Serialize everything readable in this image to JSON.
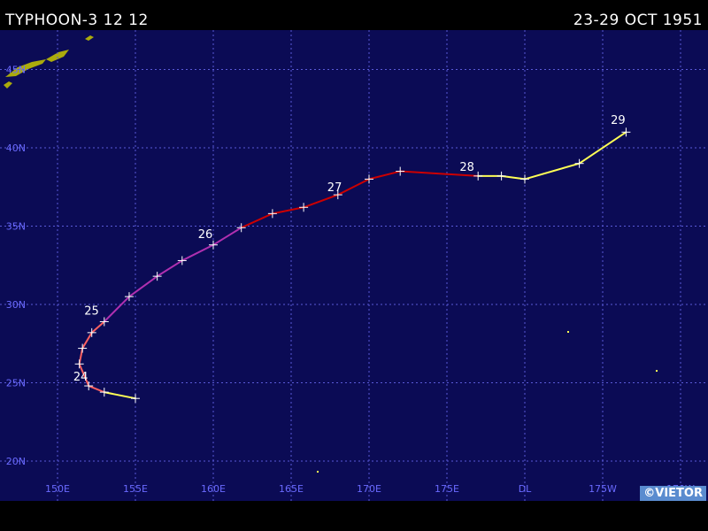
{
  "header": {
    "title": "TYPHOON-3 12 12",
    "dates": "23-29 OCT 1951"
  },
  "copyright": "©VIETOR",
  "colors": {
    "ocean": "#0b0b55",
    "grid": "#5a5ad8",
    "grid_label": "#6a6aff",
    "land": "#c8c800",
    "track_extratropical": "#ffff55",
    "track_tropical_storm": "#ff6060",
    "track_typhoon_cat1": "#cc0000",
    "track_typhoon_cat2": "#b030b0"
  },
  "axes": {
    "longitude_labels": [
      "150E",
      "155E",
      "160E",
      "165E",
      "170E",
      "175E",
      "DL",
      "175W",
      "170W"
    ],
    "latitude_labels": [
      "45N",
      "40N",
      "35N",
      "30N",
      "25N",
      "20N"
    ]
  },
  "chart_data": {
    "type": "scatter",
    "x_range_lon": [
      148,
      193
    ],
    "y_range_lat": [
      18.5,
      44.5
    ],
    "grid": true,
    "day_labels": [
      {
        "label": "24",
        "lon": 151.7,
        "lat": 24.8
      },
      {
        "label": "25",
        "lon": 152.4,
        "lat": 29.0
      },
      {
        "label": "26",
        "lon": 159.7,
        "lat": 33.9
      },
      {
        "label": "27",
        "lon": 168.0,
        "lat": 36.9
      },
      {
        "label": "28",
        "lon": 176.5,
        "lat": 38.2
      },
      {
        "label": "29",
        "lon": 186.2,
        "lat": 41.2
      }
    ],
    "track": [
      {
        "lon": 155.0,
        "lat": 24.0,
        "stage": "extratropical"
      },
      {
        "lon": 153.0,
        "lat": 24.4,
        "stage": "extratropical"
      },
      {
        "lon": 152.0,
        "lat": 24.8,
        "stage": "tropical_storm"
      },
      {
        "lon": 151.4,
        "lat": 26.2,
        "stage": "tropical_storm"
      },
      {
        "lon": 151.6,
        "lat": 27.2,
        "stage": "tropical_storm"
      },
      {
        "lon": 152.2,
        "lat": 28.2,
        "stage": "tropical_storm"
      },
      {
        "lon": 153.0,
        "lat": 28.9,
        "stage": "tropical_storm"
      },
      {
        "lon": 154.6,
        "lat": 30.5,
        "stage": "typhoon_cat2"
      },
      {
        "lon": 156.4,
        "lat": 31.8,
        "stage": "typhoon_cat2"
      },
      {
        "lon": 158.0,
        "lat": 32.8,
        "stage": "typhoon_cat2"
      },
      {
        "lon": 160.0,
        "lat": 33.8,
        "stage": "typhoon_cat2"
      },
      {
        "lon": 161.8,
        "lat": 34.9,
        "stage": "typhoon_cat2"
      },
      {
        "lon": 163.8,
        "lat": 35.8,
        "stage": "typhoon_cat1"
      },
      {
        "lon": 165.8,
        "lat": 36.2,
        "stage": "typhoon_cat1"
      },
      {
        "lon": 168.0,
        "lat": 37.0,
        "stage": "typhoon_cat1"
      },
      {
        "lon": 170.0,
        "lat": 38.0,
        "stage": "typhoon_cat1"
      },
      {
        "lon": 172.0,
        "lat": 38.5,
        "stage": "typhoon_cat1"
      },
      {
        "lon": 177.0,
        "lat": 38.2,
        "stage": "typhoon_cat1"
      },
      {
        "lon": 178.5,
        "lat": 38.2,
        "stage": "extratropical"
      },
      {
        "lon": 180.0,
        "lat": 38.0,
        "stage": "extratropical"
      },
      {
        "lon": 183.5,
        "lat": 39.0,
        "stage": "extratropical"
      },
      {
        "lon": 186.5,
        "lat": 41.0,
        "stage": "extratropical"
      }
    ]
  }
}
